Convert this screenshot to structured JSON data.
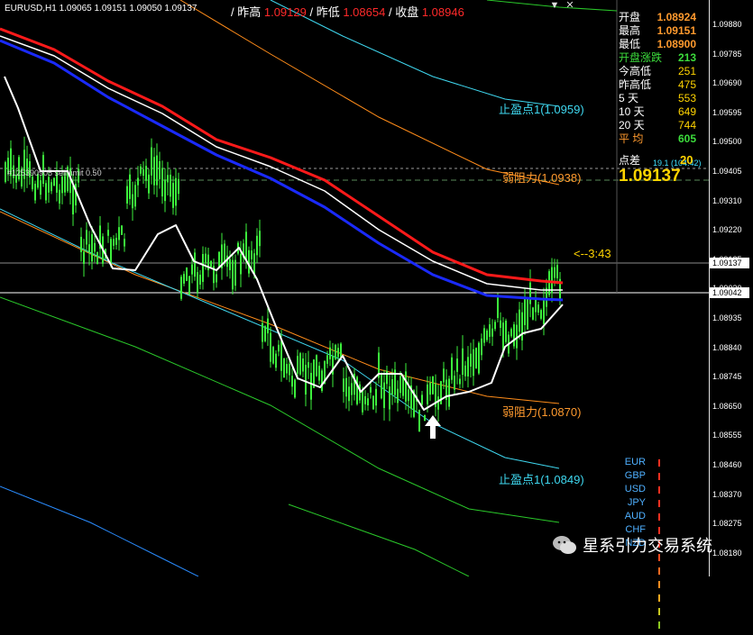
{
  "header": {
    "symbol": "EURUSD,H1  1.09065 1.09151 1.09050 1.09137",
    "stats": [
      {
        "label": "/ 昨高",
        "value": "1.09129"
      },
      {
        "label": "/ 昨低",
        "value": "1.08654"
      },
      {
        "label": "/ 收盘",
        "value": "1.08946"
      }
    ],
    "window_icons": [
      "▼",
      "✕"
    ]
  },
  "price_axis": {
    "ticks": [
      "1.09880",
      "1.09785",
      "1.09690",
      "1.09595",
      "1.09500",
      "1.09405",
      "1.09310",
      "1.09220",
      "1.09125",
      "1.09030",
      "1.08935",
      "1.08840",
      "1.08745",
      "1.08650",
      "1.08555",
      "1.08460",
      "1.08370",
      "1.08275",
      "1.08180"
    ],
    "current_price_tag": "1.09137",
    "crosshair_price_tag": "1.09042"
  },
  "info_panel": {
    "rows": [
      {
        "label": "开盘",
        "value": "1.08924",
        "label_color": "#ffffff",
        "value_color": "#ff9a2e"
      },
      {
        "label": "最高",
        "value": "1.09151",
        "label_color": "#ffffff",
        "value_color": "#ff9a2e"
      },
      {
        "label": "最低",
        "value": "1.08900",
        "label_color": "#ffffff",
        "value_color": "#ff9a2e"
      },
      {
        "label": "开盘涨跌",
        "value": "213",
        "label_color": "#3cdc3c",
        "value_color": "#3cdc3c"
      },
      {
        "label": "今高低",
        "value": "251",
        "label_color": "#ffffff",
        "value_color": "#ffd400"
      },
      {
        "label": "昨高低",
        "value": "475",
        "label_color": "#ffffff",
        "value_color": "#ffd400"
      },
      {
        "label": "5    天",
        "value": "553",
        "label_color": "#ffffff",
        "value_color": "#ffd400"
      },
      {
        "label": "10  天",
        "value": "649",
        "label_color": "#ffffff",
        "value_color": "#ffd400"
      },
      {
        "label": "20  天",
        "value": "744",
        "label_color": "#ffffff",
        "value_color": "#ffd400"
      },
      {
        "label": "平  均",
        "value": "605",
        "label_color": "#ff9a2e",
        "value_color": "#3cdc3c"
      }
    ],
    "spread_label": "点差",
    "spread_small": "19.1 (104.42)",
    "spread_value": "20",
    "big_price": "1.09137"
  },
  "chart": {
    "order_label": "#125390905 sell limit 0.50",
    "timer": "<--3:43",
    "levels": [
      {
        "text": "止盈点1(1.0959)",
        "color": "#3fd8f0"
      },
      {
        "text": "弱阻力(1.0938)",
        "color": "#ff9a2e"
      },
      {
        "text": "弱阻力(1.0870)",
        "color": "#ff9a2e"
      },
      {
        "text": "止盈点1(1.0849)",
        "color": "#3fd8f0"
      }
    ],
    "colors": {
      "candles": "#3cf03c",
      "ma_red": "#ff1a1a",
      "ma_blue": "#1a2aff",
      "ma_white": "#ffffff",
      "band_orange": "#ff8c1a",
      "band_cyan": "#3fd8f0",
      "band_green": "#2ac82a",
      "band_blue": "#2a8cff"
    }
  },
  "currency_strength": [
    {
      "name": "EUR",
      "bars": [
        "#ff3020",
        "#ff4a20",
        "#ff6a20",
        "#ff8c20",
        "#ffaa20",
        "#c8c820",
        "#8cc820"
      ]
    },
    {
      "name": "GBP",
      "bars": [
        "#ff3020",
        "#ff4a20",
        "#ff6a20",
        "#ff8c20",
        "#ffaa20",
        "#ffc820"
      ]
    },
    {
      "name": "USD",
      "bars": [
        "#ff3020",
        "#ff4a20",
        "#ff6a20"
      ]
    },
    {
      "name": "JPY",
      "bars": [
        "#ff3020",
        "#ff4a20",
        "#ff6a20",
        "#ff8c20",
        "#ffaa20"
      ]
    },
    {
      "name": "AUD",
      "bars": [
        "#ff3020",
        "#ff4a20",
        "#ff6a20",
        "#ff8c20",
        "#ffaa20",
        "#c8c820",
        "#8cc820",
        "#6cc820"
      ]
    },
    {
      "name": "CHF",
      "bars": [
        "#ff3020",
        "#ff4a20",
        "#ff6a20",
        "#ff8c20",
        "#ffaa20",
        "#c8c820"
      ]
    },
    {
      "name": "NZD",
      "bars": [
        "#ff3020",
        "#ff4a20",
        "#ff6a20",
        "#ff8c20",
        "#ffaa20",
        "#c8c820",
        "#8cc820"
      ]
    }
  ],
  "watermark": "星系引力交易系统"
}
